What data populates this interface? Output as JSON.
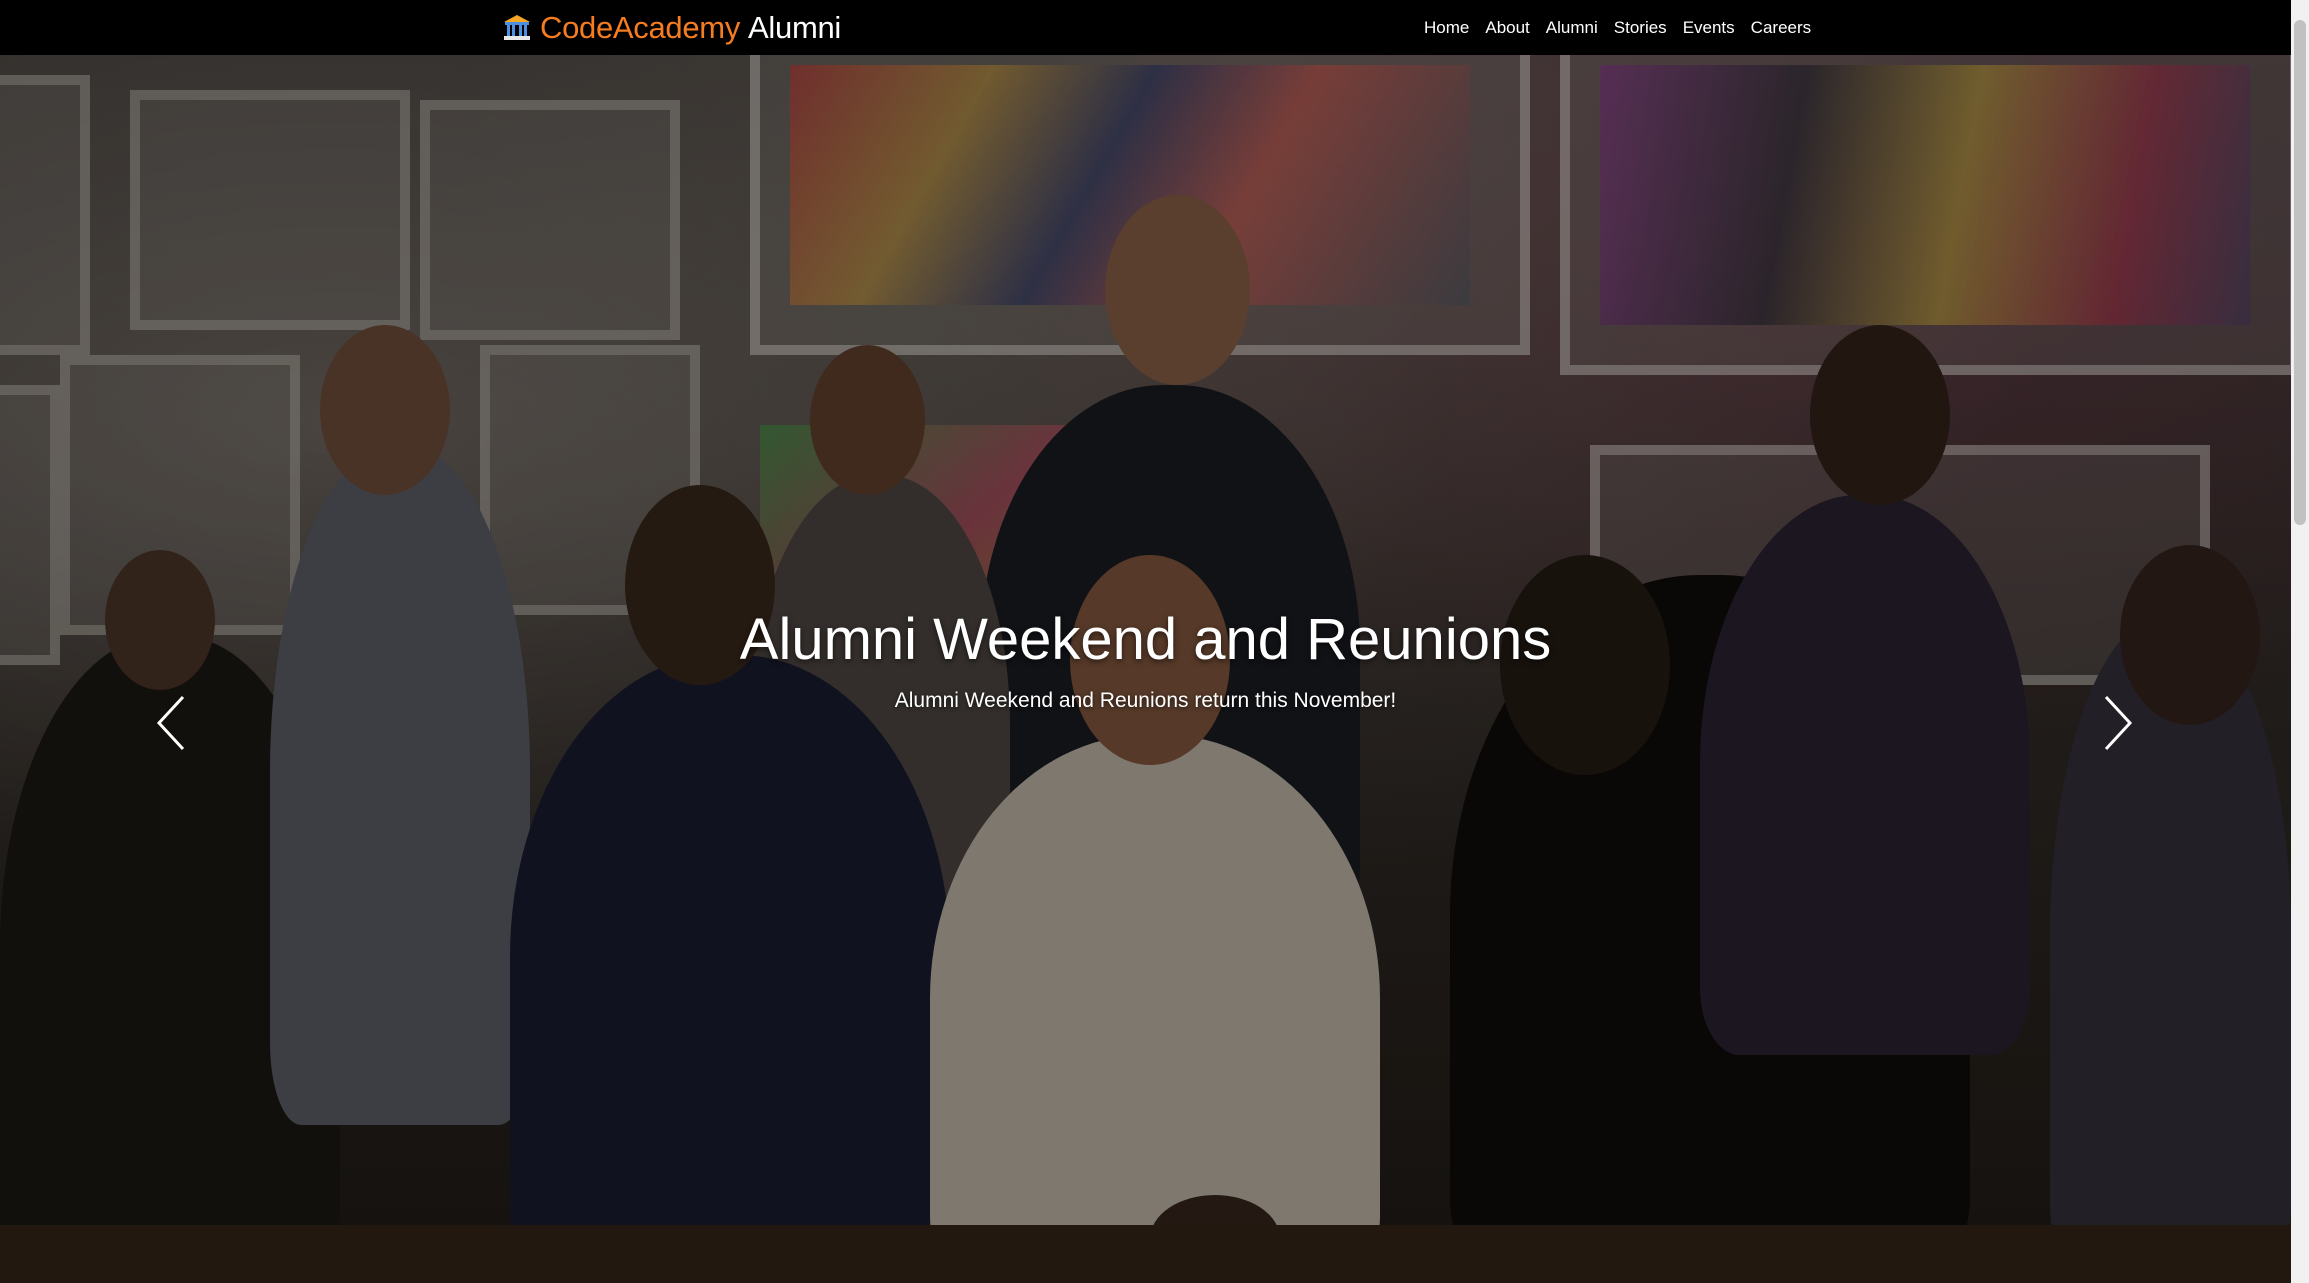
{
  "navbar": {
    "brand": {
      "icon": "institution-building-icon",
      "name_main": "CodeAcademy",
      "name_sub": "Alumni"
    },
    "links": [
      {
        "label": "Home"
      },
      {
        "label": "About"
      },
      {
        "label": "Alumni"
      },
      {
        "label": "Stories"
      },
      {
        "label": "Events"
      },
      {
        "label": "Careers"
      }
    ]
  },
  "carousel": {
    "slides_count": 3,
    "active_slide": 1,
    "caption": {
      "title": "Alumni Weekend and Reunions",
      "text": "Alumni Weekend and Reunions return this November!"
    },
    "controls": {
      "prev_icon": "chevron-left-icon",
      "next_icon": "chevron-right-icon"
    }
  },
  "colors": {
    "brand_accent": "#f57c20",
    "navbar_bg": "#000000",
    "text": "#ffffff"
  }
}
